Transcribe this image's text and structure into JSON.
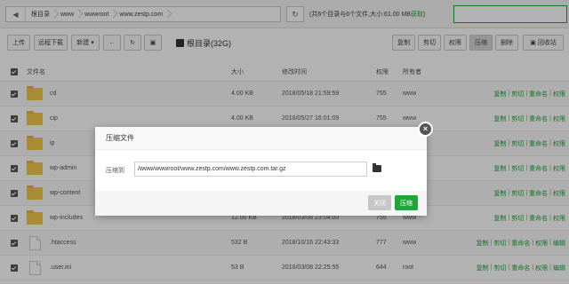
{
  "pathbar": {
    "crumbs": [
      "根目录",
      "www",
      "wwwroot",
      "www.zestp.com"
    ],
    "summary": "(共6个目录与6个文件,大小:61.00 MB",
    "fetch_link": "获取",
    "summary_end": ")"
  },
  "toolbar": {
    "upload": "上传",
    "remote_download": "远程下载",
    "new": "新建",
    "disk_label": "根目录(32G)",
    "copy": "复制",
    "cut": "剪切",
    "permission": "权限",
    "compress": "压缩",
    "delete": "删除",
    "recycle": "回收站"
  },
  "table": {
    "headers": [
      "文件名",
      "大小",
      "修改时间",
      "权限",
      "所有者"
    ],
    "rows": [
      {
        "name": "cd",
        "type": "folder",
        "size": "4.00 KB",
        "mtime": "2018/05/18 21:59:59",
        "perm": "755",
        "owner": "www"
      },
      {
        "name": "cip",
        "type": "folder",
        "size": "4.00 KB",
        "mtime": "2018/05/27 16:01:09",
        "perm": "755",
        "owner": "www"
      },
      {
        "name": "ip",
        "type": "folder",
        "size": "",
        "mtime": "",
        "perm": "",
        "owner": ""
      },
      {
        "name": "wp-admin",
        "type": "folder",
        "size": "",
        "mtime": "",
        "perm": "",
        "owner": ""
      },
      {
        "name": "wp-content",
        "type": "folder",
        "size": "",
        "mtime": "",
        "perm": "",
        "owner": ""
      },
      {
        "name": "wp-includes",
        "type": "folder",
        "size": "12.00 KB",
        "mtime": "2018/03/08 23:04:00",
        "perm": "755",
        "owner": "www"
      },
      {
        "name": ".htaccess",
        "type": "file",
        "size": "532 B",
        "mtime": "2018/10/16 22:43:33",
        "perm": "777",
        "owner": "www"
      },
      {
        "name": ".user.ini",
        "type": "file",
        "size": "53 B",
        "mtime": "2018/03/08 22:25:55",
        "perm": "644",
        "owner": "root"
      }
    ],
    "folder_ops": [
      "复制",
      "剪切",
      "重命名",
      "权限"
    ],
    "file_ops": [
      "复制",
      "剪切",
      "重命名",
      "权限",
      "编辑"
    ]
  },
  "modal": {
    "title": "压缩文件",
    "label": "压缩到",
    "value": "/www/wwwroot/www.zestp.com/www.zestp.com.tar.gz",
    "close_label": "关闭",
    "ok_label": "压缩",
    "close_x": "×"
  },
  "colors": {
    "accent": "#20a53a",
    "folder": "#f1c84b"
  }
}
